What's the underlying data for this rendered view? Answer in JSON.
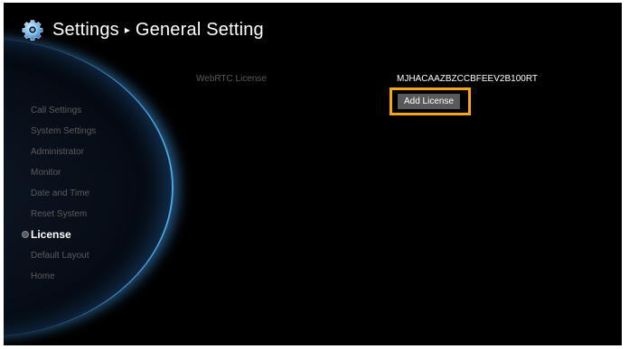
{
  "header": {
    "title": "Settings",
    "separator": "▸",
    "subtitle": "General Setting",
    "icon": "gear-icon"
  },
  "sidebar": {
    "items": [
      {
        "label": "Call Settings",
        "active": false
      },
      {
        "label": "System Settings",
        "active": false
      },
      {
        "label": "Administrator",
        "active": false
      },
      {
        "label": "Monitor",
        "active": false
      },
      {
        "label": "Date and Time",
        "active": false
      },
      {
        "label": "Reset System",
        "active": false
      },
      {
        "label": "License",
        "active": true
      },
      {
        "label": "Default Layout",
        "active": false
      },
      {
        "label": "Home",
        "active": false
      }
    ]
  },
  "license": {
    "label": "WebRTC License",
    "value": "MJHACAAZBZCCBFEEV2B100RT",
    "add_button_label": "Add License"
  },
  "colors": {
    "background": "#000000",
    "focus_highlight": "#f7a51d",
    "orb_glow": "#4da6ea",
    "inactive_text": "#5c5c5c",
    "button_bg": "#595959"
  }
}
